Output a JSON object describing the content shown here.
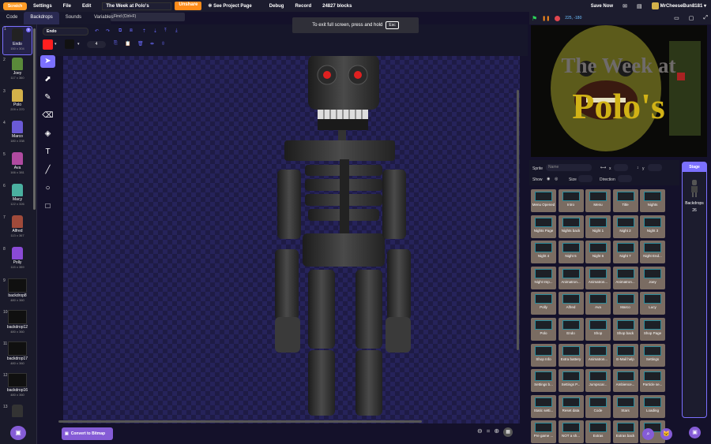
{
  "menu": {
    "logo": "Scratch",
    "items": [
      "Settings",
      "File",
      "Edit"
    ],
    "project_title": "The Week at Polo's",
    "unshare": "Unshare",
    "see_project_page": "See Project Page",
    "debug": "Debug",
    "record": "Record",
    "blocks": "24827 blocks",
    "save_now": "Save Now",
    "username": "MrCheeseBun8181",
    "find_hint": "Find (Ctrl+F)"
  },
  "tabs": [
    "Code",
    "Backdrops",
    "Sounds",
    "Variables"
  ],
  "costumes": [
    {
      "num": "1",
      "name": "Endo",
      "size": "150 x 304"
    },
    {
      "num": "2",
      "name": "Joey",
      "size": "117 x 360"
    },
    {
      "num": "3",
      "name": "Polo",
      "size": "209 x 370"
    },
    {
      "num": "4",
      "name": "Marco",
      "size": "180 x 338"
    },
    {
      "num": "5",
      "name": "Ava",
      "size": "166 x 381"
    },
    {
      "num": "6",
      "name": "Macy",
      "size": "122 x 326"
    },
    {
      "num": "7",
      "name": "Alfred",
      "size": "113 x 367"
    },
    {
      "num": "8",
      "name": "Polly",
      "size": "115 x 359"
    },
    {
      "num": "9",
      "name": "backdrop8",
      "size": "480 x 360"
    },
    {
      "num": "10",
      "name": "backdrop12",
      "size": "480 x 360"
    },
    {
      "num": "11",
      "name": "backdrop17",
      "size": "480 x 360"
    },
    {
      "num": "12",
      "name": "backdrop16",
      "size": "480 x 360"
    },
    {
      "num": "13",
      "name": "",
      "size": ""
    }
  ],
  "paint": {
    "costume_name": "Endo",
    "brush_size": "4",
    "fill_color": "#ff1f1f",
    "convert_button": "Convert to Bitmap"
  },
  "fullscreen": {
    "text": "To exit full screen, press and hold",
    "key": "Esc"
  },
  "stage": {
    "coords": "225, -180",
    "title_line1": "The Week at",
    "title_line2": "Polo's"
  },
  "sprite_info": {
    "sprite_label": "Sprite",
    "name_placeholder": "Name",
    "x_label": "x",
    "y_label": "y",
    "show_label": "Show",
    "size_label": "Size",
    "direction_label": "Direction"
  },
  "sprites": [
    "Menu Opened",
    "Intro",
    "Menu",
    "Title",
    "Nights",
    "Nights Page",
    "Nights back",
    "Night 1",
    "Night 2",
    "Night 3",
    "Night 4",
    "Night 5",
    "Night 6",
    "Night 7",
    "Night End...",
    "Night Imp...",
    "Animatron...",
    "Animatron...",
    "Animatron...",
    "Joey",
    "Polly",
    "Alfred",
    "Ava",
    "Marco",
    "Lucy",
    "Polo",
    "Endo",
    "Shop",
    "Shop back",
    "Shop Page",
    "Shop Info",
    "Extra battery",
    "Animatron...",
    "E-Mail help",
    "Settings",
    "Settings b...",
    "Settings P...",
    "Jumpscar...",
    "Ambience...",
    "Particle se...",
    "Static setti...",
    "Reset data",
    "Code",
    "Stars",
    "Loading",
    "Pre game ...",
    "NOT a sh...",
    "Extras",
    "Extras back",
    ""
  ],
  "stage_panel": {
    "header": "Stage",
    "backdrops_label": "Backdrops",
    "count": "26"
  }
}
